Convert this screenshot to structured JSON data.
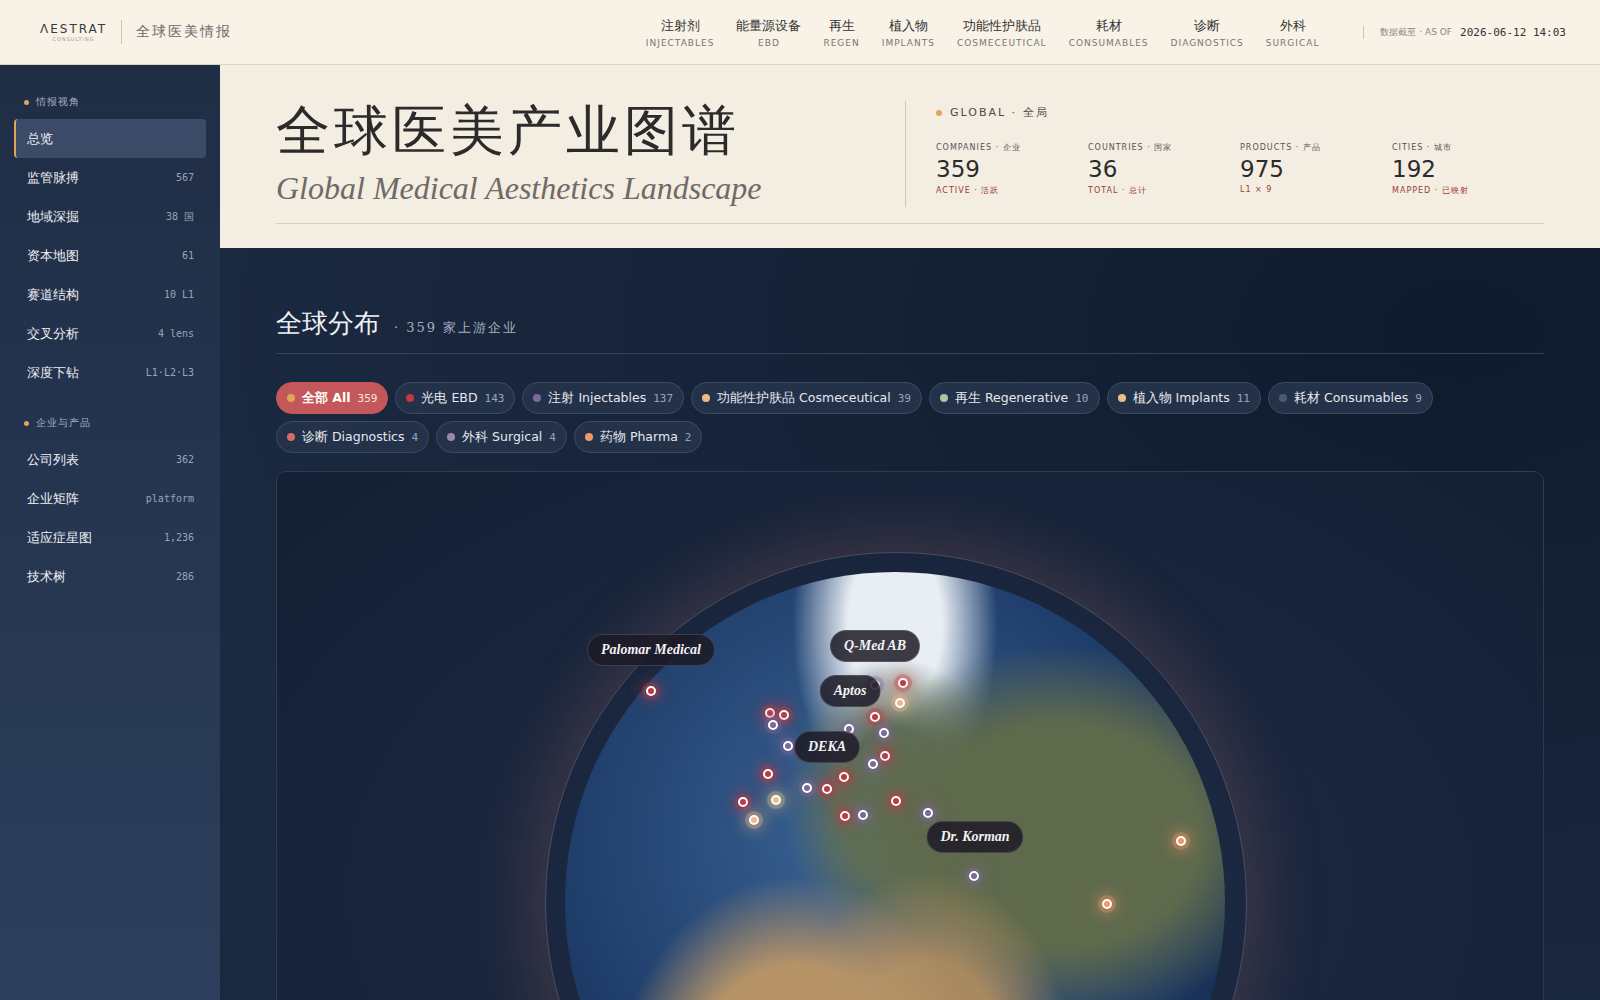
{
  "header": {
    "logo": {
      "mark": "ΛESTRAT",
      "sub": "CONSULTING"
    },
    "title": "全球医美情报",
    "nav": [
      {
        "zh": "注射剂",
        "en": "INJECTABLES"
      },
      {
        "zh": "能量源设备",
        "en": "EBD"
      },
      {
        "zh": "再生",
        "en": "REGEN"
      },
      {
        "zh": "植入物",
        "en": "IMPLANTS"
      },
      {
        "zh": "功能性护肤品",
        "en": "COSMECEUTICAL"
      },
      {
        "zh": "耗材",
        "en": "CONSUMABLES"
      },
      {
        "zh": "诊断",
        "en": "DIAGNOSTICS"
      },
      {
        "zh": "外科",
        "en": "SURGICAL"
      }
    ],
    "asof": {
      "label": "数据截至 · AS OF",
      "value": "2026-06-12 14:03"
    }
  },
  "sidebar": {
    "sections": [
      {
        "title": "情报视角",
        "items": [
          {
            "label": "总览",
            "count": "",
            "selected": true
          },
          {
            "label": "监管脉搏",
            "count": "567",
            "selected": false
          },
          {
            "label": "地域深掘",
            "count": "38 国",
            "selected": false
          },
          {
            "label": "资本地图",
            "count": "61",
            "selected": false
          },
          {
            "label": "赛道结构",
            "count": "10 L1",
            "selected": false
          },
          {
            "label": "交叉分析",
            "count": "4 lens",
            "selected": false
          },
          {
            "label": "深度下钻",
            "count": "L1·L2·L3",
            "selected": false
          }
        ]
      },
      {
        "title": "企业与产品",
        "items": [
          {
            "label": "公司列表",
            "count": "362",
            "selected": false
          },
          {
            "label": "企业矩阵",
            "count": "platform",
            "selected": false
          },
          {
            "label": "适应症星图",
            "count": "1,236",
            "selected": false
          },
          {
            "label": "技术树",
            "count": "286",
            "selected": false
          }
        ]
      }
    ]
  },
  "hero": {
    "title": "全球医美产业图谱",
    "subtitle": "Global Medical Aesthetics Landscape",
    "scope": "GLOBAL · 全局",
    "stats": [
      {
        "label": "COMPANIES · 企业",
        "value": "359",
        "sub": "ACTIVE · 活跃"
      },
      {
        "label": "COUNTRIES · 国家",
        "value": "36",
        "sub": "TOTAL · 总计"
      },
      {
        "label": "PRODUCTS · 产品",
        "value": "975",
        "sub": "L1 × 9"
      },
      {
        "label": "CITIES · 城市",
        "value": "192",
        "sub": "MAPPED · 已映射"
      }
    ]
  },
  "distribution": {
    "title": "全球分布",
    "subtitle": "· 359 家上游企业",
    "filters": [
      {
        "label": "全部 All",
        "count": "359",
        "color": "#e0a45a",
        "selected": true
      },
      {
        "label": "光电 EBD",
        "count": "143",
        "color": "#c0393f",
        "selected": false
      },
      {
        "label": "注射 Injectables",
        "count": "137",
        "color": "#7a6a9a",
        "selected": false
      },
      {
        "label": "功能性护肤品 Cosmeceutical",
        "count": "39",
        "color": "#f0b78a",
        "selected": false
      },
      {
        "label": "再生 Regenerative",
        "count": "10",
        "color": "#a8c79a",
        "selected": false
      },
      {
        "label": "植入物 Implants",
        "count": "11",
        "color": "#e6c08a",
        "selected": false
      },
      {
        "label": "耗材 Consumables",
        "count": "9",
        "color": "#4a5a72",
        "selected": false
      },
      {
        "label": "诊断 Diagnostics",
        "count": "4",
        "color": "#d46a6a",
        "selected": false
      },
      {
        "label": "外科 Surgical",
        "count": "4",
        "color": "#9a88a8",
        "selected": false
      },
      {
        "label": "药物 Pharma",
        "count": "2",
        "color": "#f0966a",
        "selected": false
      }
    ],
    "globe": {
      "labels": [
        "Palomar Medical",
        "Q-Med AB",
        "Aptos",
        "DEKA",
        "Dr. Korman"
      ],
      "pins": [
        {
          "color": "#c0393f"
        },
        {
          "color": "#7a6a9a"
        },
        {
          "color": "#c0393f"
        },
        {
          "color": "#f0b78a"
        },
        {
          "color": "#c0393f"
        },
        {
          "color": "#c0393f"
        },
        {
          "color": "#7a6a9a"
        },
        {
          "color": "#7a6a9a"
        },
        {
          "color": "#7a6a9a"
        },
        {
          "color": "#c0393f"
        },
        {
          "color": "#7a6a9a"
        },
        {
          "color": "#c0393f"
        },
        {
          "color": "#7a6a9a"
        },
        {
          "color": "#c0393f"
        },
        {
          "color": "#c0393f"
        },
        {
          "color": "#7a6a9a"
        },
        {
          "color": "#e6c08a"
        },
        {
          "color": "#c0393f"
        },
        {
          "color": "#f0b78a"
        },
        {
          "color": "#c0393f"
        },
        {
          "color": "#c0393f"
        },
        {
          "color": "#7a6a9a"
        },
        {
          "color": "#c0393f"
        },
        {
          "color": "#7a6a9a"
        },
        {
          "color": "#7a6a9a"
        },
        {
          "color": "#f0966a"
        },
        {
          "color": "#f0966a"
        }
      ]
    }
  }
}
